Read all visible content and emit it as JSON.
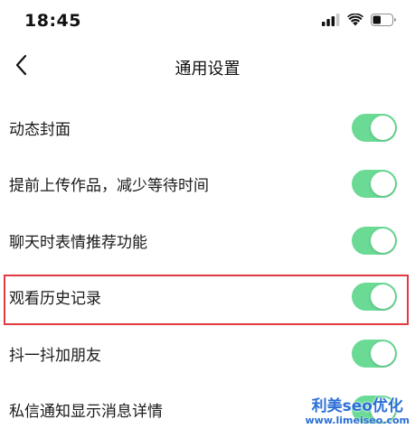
{
  "status_bar": {
    "time": "18:45",
    "icons": [
      "signal-icon",
      "wifi-icon",
      "battery-icon"
    ]
  },
  "nav": {
    "back_icon": "chevron-left-icon",
    "title": "通用设置"
  },
  "settings": [
    {
      "label": "动态封面",
      "enabled": true
    },
    {
      "label": "提前上传作品，减少等待时间",
      "enabled": true
    },
    {
      "label": "聊天时表情推荐功能",
      "enabled": true
    },
    {
      "label": "观看历史记录",
      "enabled": true,
      "highlighted": true
    },
    {
      "label": "抖一抖加朋友",
      "enabled": true
    },
    {
      "label": "私信通知显示消息详情",
      "enabled": true
    }
  ],
  "colors": {
    "toggle_on": "#6ada95",
    "highlight_border": "#e0393e",
    "watermark": "#2b6fd6"
  },
  "watermark": {
    "title": "利美seo优化",
    "url": "www.limeiseo.com"
  }
}
